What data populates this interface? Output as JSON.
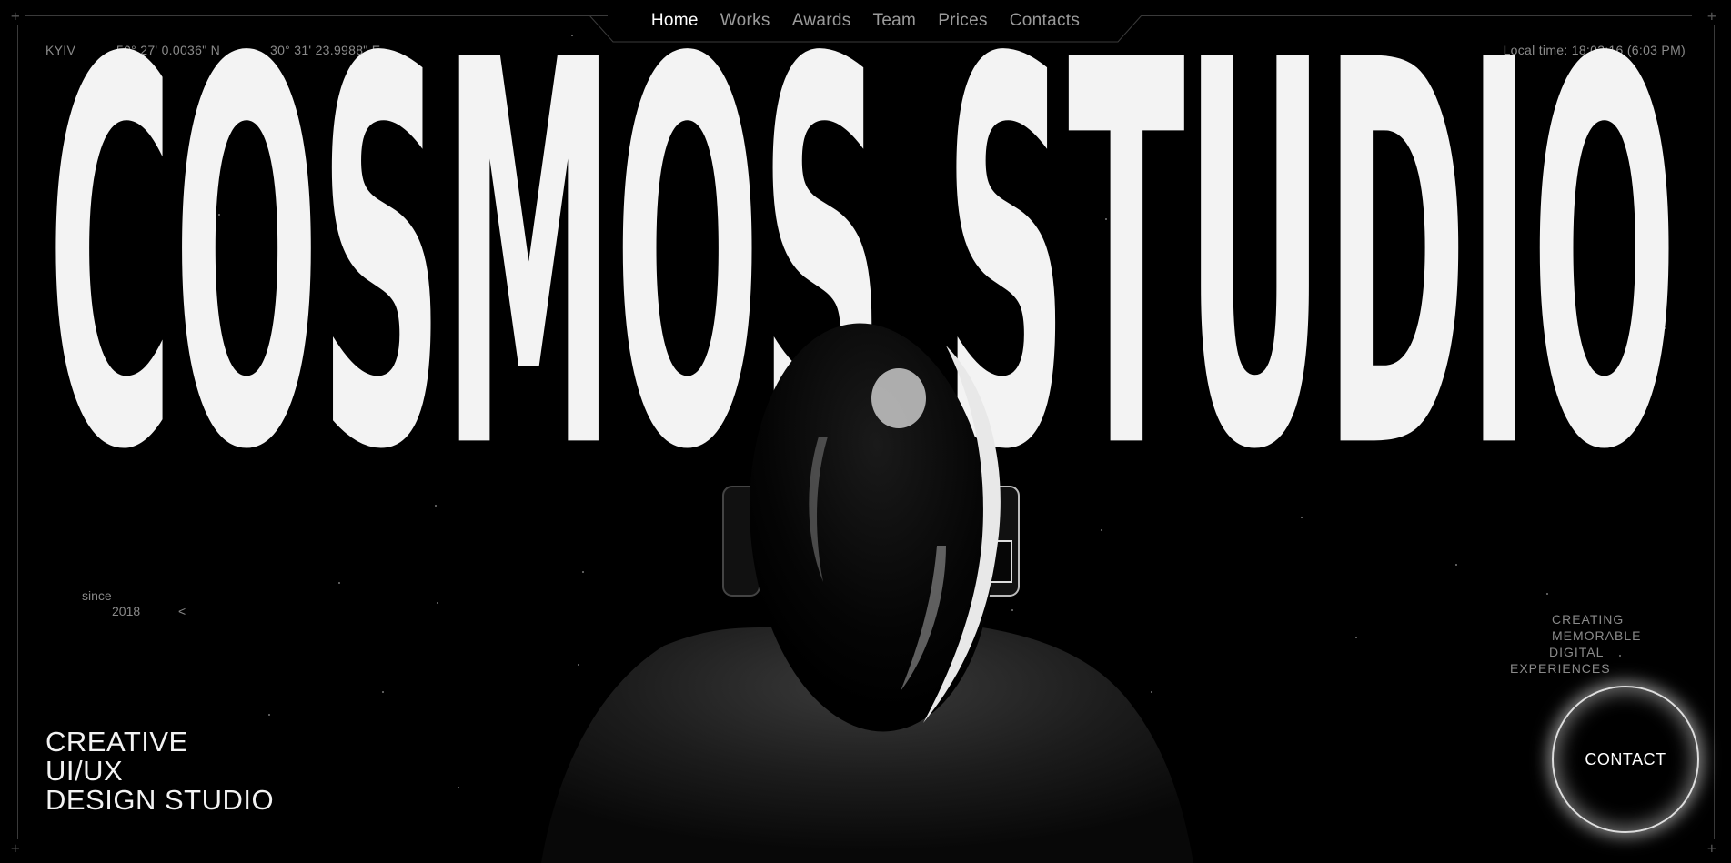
{
  "nav": {
    "items": [
      {
        "label": "Home",
        "active": true
      },
      {
        "label": "Works",
        "active": false
      },
      {
        "label": "Awards",
        "active": false
      },
      {
        "label": "Team",
        "active": false
      },
      {
        "label": "Prices",
        "active": false
      },
      {
        "label": "Contacts",
        "active": false
      }
    ]
  },
  "meta": {
    "city": "KYIV",
    "latitude": "50° 27' 0.0036\" N",
    "longitude": "30° 31' 23.9988\" E",
    "local_time": "Local time: 18:03:16 (6:03 PM)"
  },
  "hero": {
    "title": "COSMOS STUDIO",
    "since_label": "since",
    "since_year": "2018",
    "since_arrow": "<",
    "tagline": [
      "CREATIVE",
      "UI/UX",
      "DESIGN STUDIO"
    ],
    "creating": [
      "CREATING",
      "MEMORABLE",
      "DIGITAL",
      "EXPERIENCES"
    ],
    "contact_label": "CONTACT"
  },
  "colors": {
    "background": "#000000",
    "title": "#f3f3f3",
    "accent_glow": "#ffffff"
  }
}
